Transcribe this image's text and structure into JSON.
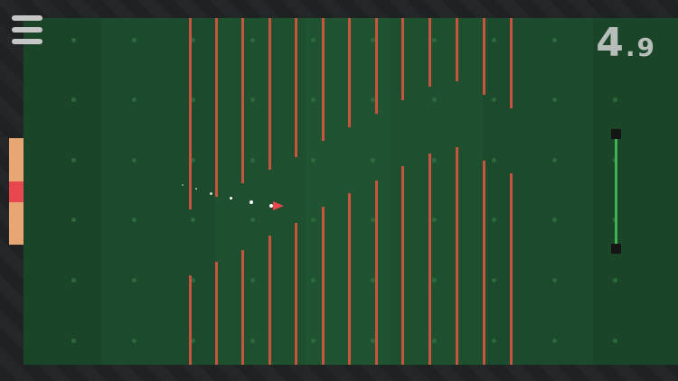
{
  "hud": {
    "score_int": "4",
    "score_dec": ".9"
  },
  "colors": {
    "field": "#1c4a2c",
    "wall": "#c8533f",
    "gauge": "#e8a675",
    "gauge_marker": "#e8474e",
    "slider_track": "#3fb34f",
    "player": "#e8474e"
  },
  "icons": {
    "menu": "hamburger-menu-icon",
    "player": "arrow-ship-icon"
  },
  "gauge_level": 0.5,
  "slider_level": 1.0
}
